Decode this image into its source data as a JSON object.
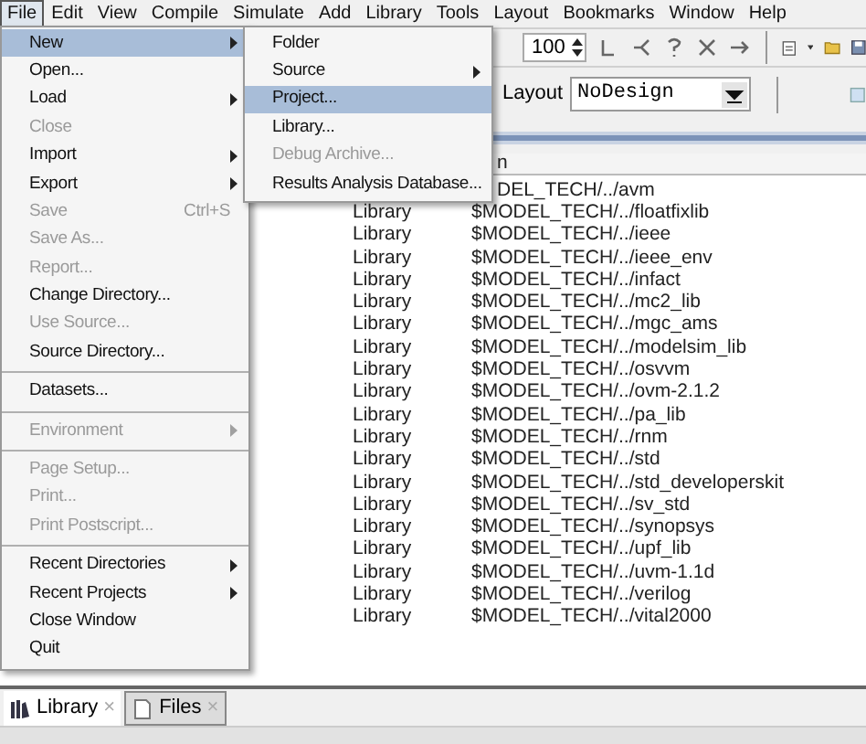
{
  "menu_bar": [
    {
      "label": "File",
      "selected": true
    },
    {
      "label": "Edit",
      "selected": false
    },
    {
      "label": "View",
      "selected": false
    },
    {
      "label": "Compile",
      "selected": false
    },
    {
      "label": "Simulate",
      "selected": false
    },
    {
      "label": "Add",
      "selected": false
    },
    {
      "label": "Library",
      "selected": false
    },
    {
      "label": "Tools",
      "selected": false
    },
    {
      "label": "Layout",
      "selected": false
    },
    {
      "label": "Bookmarks",
      "selected": false
    },
    {
      "label": "Window",
      "selected": false
    },
    {
      "label": "Help",
      "selected": false
    }
  ],
  "file_menu": [
    {
      "kind": "item",
      "label": "New",
      "submenu": true,
      "disabled": false,
      "selected": true
    },
    {
      "kind": "item",
      "label": "Open...",
      "submenu": false,
      "disabled": false,
      "selected": false
    },
    {
      "kind": "item",
      "label": "Load",
      "submenu": true,
      "disabled": false,
      "selected": false
    },
    {
      "kind": "item",
      "label": "Close",
      "submenu": false,
      "disabled": true,
      "selected": false
    },
    {
      "kind": "item",
      "label": "Import",
      "submenu": true,
      "disabled": false,
      "selected": false
    },
    {
      "kind": "item",
      "label": "Export",
      "submenu": true,
      "disabled": false,
      "selected": false
    },
    {
      "kind": "item",
      "label": "Save",
      "shortcut": "Ctrl+S",
      "submenu": false,
      "disabled": true,
      "selected": false
    },
    {
      "kind": "item",
      "label": "Save As...",
      "submenu": false,
      "disabled": true,
      "selected": false
    },
    {
      "kind": "item",
      "label": "Report...",
      "submenu": false,
      "disabled": true,
      "selected": false
    },
    {
      "kind": "item",
      "label": "Change Directory...",
      "submenu": false,
      "disabled": false,
      "selected": false
    },
    {
      "kind": "item",
      "label": "Use Source...",
      "submenu": false,
      "disabled": true,
      "selected": false
    },
    {
      "kind": "item",
      "label": "Source Directory...",
      "submenu": false,
      "disabled": false,
      "selected": false
    },
    {
      "kind": "separator"
    },
    {
      "kind": "item",
      "label": "Datasets...",
      "submenu": false,
      "disabled": false,
      "selected": false
    },
    {
      "kind": "separator"
    },
    {
      "kind": "item",
      "label": "Environment",
      "submenu": true,
      "disabled": true,
      "selected": false
    },
    {
      "kind": "separator"
    },
    {
      "kind": "item",
      "label": "Page Setup...",
      "submenu": false,
      "disabled": true,
      "selected": false
    },
    {
      "kind": "item",
      "label": "Print...",
      "submenu": false,
      "disabled": true,
      "selected": false
    },
    {
      "kind": "item",
      "label": "Print Postscript...",
      "submenu": false,
      "disabled": true,
      "selected": false
    },
    {
      "kind": "separator"
    },
    {
      "kind": "item",
      "label": "Recent Directories",
      "submenu": true,
      "disabled": false,
      "selected": false
    },
    {
      "kind": "item",
      "label": "Recent Projects",
      "submenu": true,
      "disabled": false,
      "selected": false
    },
    {
      "kind": "item",
      "label": "Close Window",
      "submenu": false,
      "disabled": false,
      "selected": false
    },
    {
      "kind": "item",
      "label": "Quit",
      "submenu": false,
      "disabled": false,
      "selected": false
    }
  ],
  "new_submenu": [
    {
      "label": "Folder",
      "submenu": false,
      "disabled": false,
      "selected": false
    },
    {
      "label": "Source",
      "submenu": true,
      "disabled": false,
      "selected": false
    },
    {
      "label": "Project...",
      "submenu": false,
      "disabled": false,
      "selected": true
    },
    {
      "label": "Library...",
      "submenu": false,
      "disabled": false,
      "selected": false
    },
    {
      "label": "Debug Archive...",
      "submenu": false,
      "disabled": true,
      "selected": false
    },
    {
      "label": "Results Analysis Database...",
      "submenu": false,
      "disabled": false,
      "selected": false
    }
  ],
  "toolbar": {
    "zoom_value": "100",
    "layout_label": "Layout",
    "layout_value": "NoDesign"
  },
  "table": {
    "column_3": "n",
    "rows": [
      {
        "path": "DEL_TECH/../avm"
      },
      {
        "type": "Library",
        "path": "$MODEL_TECH/../floatfixlib"
      },
      {
        "type": "Library",
        "path": "$MODEL_TECH/../ieee"
      },
      {
        "type": "Library",
        "path": "$MODEL_TECH/../ieee_env"
      },
      {
        "type": "Library",
        "path": "$MODEL_TECH/../infact"
      },
      {
        "type": "Library",
        "path": "$MODEL_TECH/../mc2_lib"
      },
      {
        "type": "Library",
        "path": "$MODEL_TECH/../mgc_ams"
      },
      {
        "type": "Library",
        "path": "$MODEL_TECH/../modelsim_lib"
      },
      {
        "type": "Library",
        "path": "$MODEL_TECH/../osvvm"
      },
      {
        "type": "Library",
        "path": "$MODEL_TECH/../ovm-2.1.2"
      },
      {
        "type": "Library",
        "path": "$MODEL_TECH/../pa_lib"
      },
      {
        "type": "Library",
        "path": "$MODEL_TECH/../rnm"
      },
      {
        "type": "Library",
        "path": "$MODEL_TECH/../std"
      },
      {
        "type": "Library",
        "path": "$MODEL_TECH/../std_developerskit"
      },
      {
        "type": "Library",
        "path": "$MODEL_TECH/../sv_std"
      },
      {
        "type": "Library",
        "path": "$MODEL_TECH/../synopsys"
      },
      {
        "type": "Library",
        "path": "$MODEL_TECH/../upf_lib"
      },
      {
        "type": "Library",
        "path": "$MODEL_TECH/../uvm-1.1d"
      },
      {
        "type": "Library",
        "path": "$MODEL_TECH/../verilog"
      },
      {
        "type": "Library",
        "path": "$MODEL_TECH/../vital2000"
      }
    ]
  },
  "bottom_tabs": [
    {
      "label": "Library",
      "close": "×",
      "selected": true
    },
    {
      "label": "Files",
      "close": "×",
      "selected": false
    }
  ]
}
